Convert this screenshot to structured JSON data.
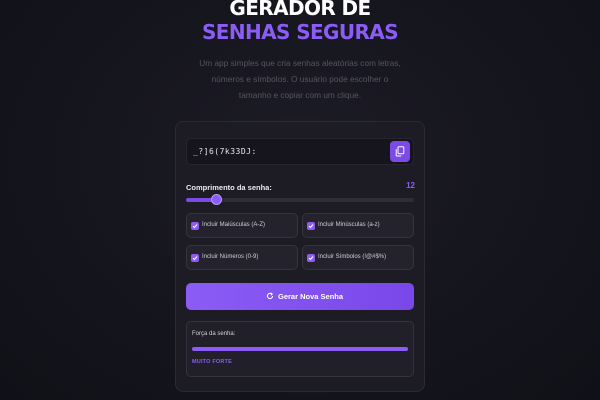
{
  "header": {
    "title_line1": "GERADOR DE",
    "title_line2": "SENHAS SEGURAS",
    "description": "Um app simples que cria senhas aleatórias com letras, números e símbolos. O usuário pode escolher o tamanho e copiar com um clique."
  },
  "password": {
    "value": "_?]6(7k33DJ:",
    "copy_icon": "copy-icon"
  },
  "length": {
    "label": "Comprimento da senha:",
    "value": "12",
    "min": 4,
    "max": 64
  },
  "options": [
    {
      "label": "Incluir Maiúsculas (A-Z)",
      "checked": true
    },
    {
      "label": "Incluir Minúsculas (a-z)",
      "checked": true
    },
    {
      "label": "Incluir Números (0-9)",
      "checked": true
    },
    {
      "label": "Incluir Símbolos (!@#$%)",
      "checked": true
    }
  ],
  "generate": {
    "label": "Gerar Nova Senha",
    "icon": "refresh-icon"
  },
  "strength": {
    "label": "Força da senha:",
    "level": "MUITO FORTE",
    "fraction": 1.0,
    "color": "#8b5cf6"
  },
  "colors": {
    "accent": "#8b5cf6",
    "accent_dark": "#7c4ae6",
    "background": "#15151d",
    "card": "#1d1c25"
  }
}
